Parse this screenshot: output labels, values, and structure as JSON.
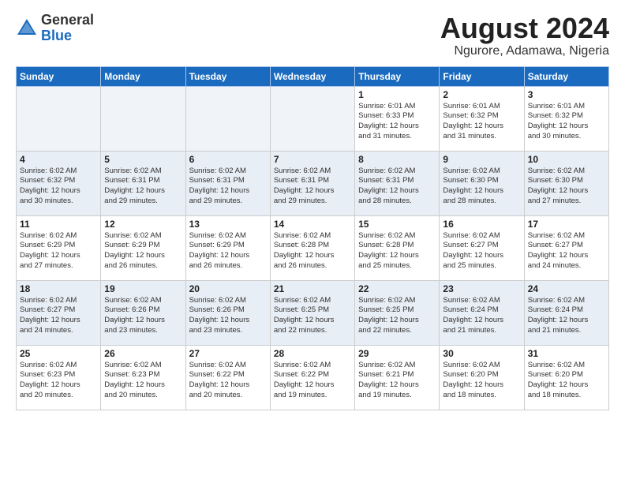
{
  "logo": {
    "general": "General",
    "blue": "Blue"
  },
  "title": {
    "month_year": "August 2024",
    "location": "Ngurore, Adamawa, Nigeria"
  },
  "days_of_week": [
    "Sunday",
    "Monday",
    "Tuesday",
    "Wednesday",
    "Thursday",
    "Friday",
    "Saturday"
  ],
  "weeks": [
    [
      {
        "day": "",
        "text": "",
        "empty": true
      },
      {
        "day": "",
        "text": "",
        "empty": true
      },
      {
        "day": "",
        "text": "",
        "empty": true
      },
      {
        "day": "",
        "text": "",
        "empty": true
      },
      {
        "day": "1",
        "text": "Sunrise: 6:01 AM\nSunset: 6:33 PM\nDaylight: 12 hours\nand 31 minutes.",
        "empty": false
      },
      {
        "day": "2",
        "text": "Sunrise: 6:01 AM\nSunset: 6:32 PM\nDaylight: 12 hours\nand 31 minutes.",
        "empty": false
      },
      {
        "day": "3",
        "text": "Sunrise: 6:01 AM\nSunset: 6:32 PM\nDaylight: 12 hours\nand 30 minutes.",
        "empty": false
      }
    ],
    [
      {
        "day": "4",
        "text": "Sunrise: 6:02 AM\nSunset: 6:32 PM\nDaylight: 12 hours\nand 30 minutes.",
        "empty": false
      },
      {
        "day": "5",
        "text": "Sunrise: 6:02 AM\nSunset: 6:31 PM\nDaylight: 12 hours\nand 29 minutes.",
        "empty": false
      },
      {
        "day": "6",
        "text": "Sunrise: 6:02 AM\nSunset: 6:31 PM\nDaylight: 12 hours\nand 29 minutes.",
        "empty": false
      },
      {
        "day": "7",
        "text": "Sunrise: 6:02 AM\nSunset: 6:31 PM\nDaylight: 12 hours\nand 29 minutes.",
        "empty": false
      },
      {
        "day": "8",
        "text": "Sunrise: 6:02 AM\nSunset: 6:31 PM\nDaylight: 12 hours\nand 28 minutes.",
        "empty": false
      },
      {
        "day": "9",
        "text": "Sunrise: 6:02 AM\nSunset: 6:30 PM\nDaylight: 12 hours\nand 28 minutes.",
        "empty": false
      },
      {
        "day": "10",
        "text": "Sunrise: 6:02 AM\nSunset: 6:30 PM\nDaylight: 12 hours\nand 27 minutes.",
        "empty": false
      }
    ],
    [
      {
        "day": "11",
        "text": "Sunrise: 6:02 AM\nSunset: 6:29 PM\nDaylight: 12 hours\nand 27 minutes.",
        "empty": false
      },
      {
        "day": "12",
        "text": "Sunrise: 6:02 AM\nSunset: 6:29 PM\nDaylight: 12 hours\nand 26 minutes.",
        "empty": false
      },
      {
        "day": "13",
        "text": "Sunrise: 6:02 AM\nSunset: 6:29 PM\nDaylight: 12 hours\nand 26 minutes.",
        "empty": false
      },
      {
        "day": "14",
        "text": "Sunrise: 6:02 AM\nSunset: 6:28 PM\nDaylight: 12 hours\nand 26 minutes.",
        "empty": false
      },
      {
        "day": "15",
        "text": "Sunrise: 6:02 AM\nSunset: 6:28 PM\nDaylight: 12 hours\nand 25 minutes.",
        "empty": false
      },
      {
        "day": "16",
        "text": "Sunrise: 6:02 AM\nSunset: 6:27 PM\nDaylight: 12 hours\nand 25 minutes.",
        "empty": false
      },
      {
        "day": "17",
        "text": "Sunrise: 6:02 AM\nSunset: 6:27 PM\nDaylight: 12 hours\nand 24 minutes.",
        "empty": false
      }
    ],
    [
      {
        "day": "18",
        "text": "Sunrise: 6:02 AM\nSunset: 6:27 PM\nDaylight: 12 hours\nand 24 minutes.",
        "empty": false
      },
      {
        "day": "19",
        "text": "Sunrise: 6:02 AM\nSunset: 6:26 PM\nDaylight: 12 hours\nand 23 minutes.",
        "empty": false
      },
      {
        "day": "20",
        "text": "Sunrise: 6:02 AM\nSunset: 6:26 PM\nDaylight: 12 hours\nand 23 minutes.",
        "empty": false
      },
      {
        "day": "21",
        "text": "Sunrise: 6:02 AM\nSunset: 6:25 PM\nDaylight: 12 hours\nand 22 minutes.",
        "empty": false
      },
      {
        "day": "22",
        "text": "Sunrise: 6:02 AM\nSunset: 6:25 PM\nDaylight: 12 hours\nand 22 minutes.",
        "empty": false
      },
      {
        "day": "23",
        "text": "Sunrise: 6:02 AM\nSunset: 6:24 PM\nDaylight: 12 hours\nand 21 minutes.",
        "empty": false
      },
      {
        "day": "24",
        "text": "Sunrise: 6:02 AM\nSunset: 6:24 PM\nDaylight: 12 hours\nand 21 minutes.",
        "empty": false
      }
    ],
    [
      {
        "day": "25",
        "text": "Sunrise: 6:02 AM\nSunset: 6:23 PM\nDaylight: 12 hours\nand 20 minutes.",
        "empty": false
      },
      {
        "day": "26",
        "text": "Sunrise: 6:02 AM\nSunset: 6:23 PM\nDaylight: 12 hours\nand 20 minutes.",
        "empty": false
      },
      {
        "day": "27",
        "text": "Sunrise: 6:02 AM\nSunset: 6:22 PM\nDaylight: 12 hours\nand 20 minutes.",
        "empty": false
      },
      {
        "day": "28",
        "text": "Sunrise: 6:02 AM\nSunset: 6:22 PM\nDaylight: 12 hours\nand 19 minutes.",
        "empty": false
      },
      {
        "day": "29",
        "text": "Sunrise: 6:02 AM\nSunset: 6:21 PM\nDaylight: 12 hours\nand 19 minutes.",
        "empty": false
      },
      {
        "day": "30",
        "text": "Sunrise: 6:02 AM\nSunset: 6:20 PM\nDaylight: 12 hours\nand 18 minutes.",
        "empty": false
      },
      {
        "day": "31",
        "text": "Sunrise: 6:02 AM\nSunset: 6:20 PM\nDaylight: 12 hours\nand 18 minutes.",
        "empty": false
      }
    ]
  ]
}
